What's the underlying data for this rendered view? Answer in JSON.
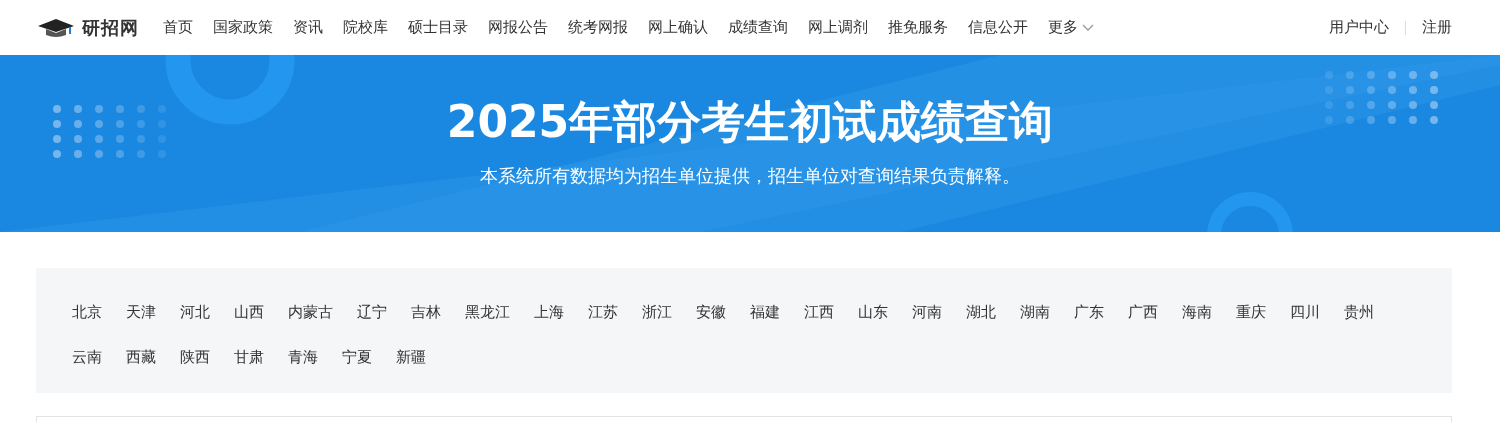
{
  "header": {
    "logo": "研招网",
    "nav": [
      {
        "label": "首页"
      },
      {
        "label": "国家政策"
      },
      {
        "label": "资讯"
      },
      {
        "label": "院校库"
      },
      {
        "label": "硕士目录"
      },
      {
        "label": "网报公告"
      },
      {
        "label": "统考网报"
      },
      {
        "label": "网上确认"
      },
      {
        "label": "成绩查询"
      },
      {
        "label": "网上调剂"
      },
      {
        "label": "推免服务"
      },
      {
        "label": "信息公开"
      },
      {
        "label": "更多",
        "kind": "dropdown"
      }
    ],
    "user_links": [
      "用户中心",
      "注册"
    ]
  },
  "banner": {
    "title": "2025年部分考生初试成绩查询",
    "subtitle": "本系统所有数据均为招生单位提供，招生单位对查询结果负责解释。"
  },
  "provinces": [
    "北京",
    "天津",
    "河北",
    "山西",
    "内蒙古",
    "辽宁",
    "吉林",
    "黑龙江",
    "上海",
    "江苏",
    "浙江",
    "安徽",
    "福建",
    "江西",
    "山东",
    "河南",
    "湖北",
    "湖南",
    "广东",
    "广西",
    "海南",
    "重庆",
    "四川",
    "贵州",
    "云南",
    "西藏",
    "陕西",
    "甘肃",
    "青海",
    "宁夏",
    "新疆"
  ]
}
